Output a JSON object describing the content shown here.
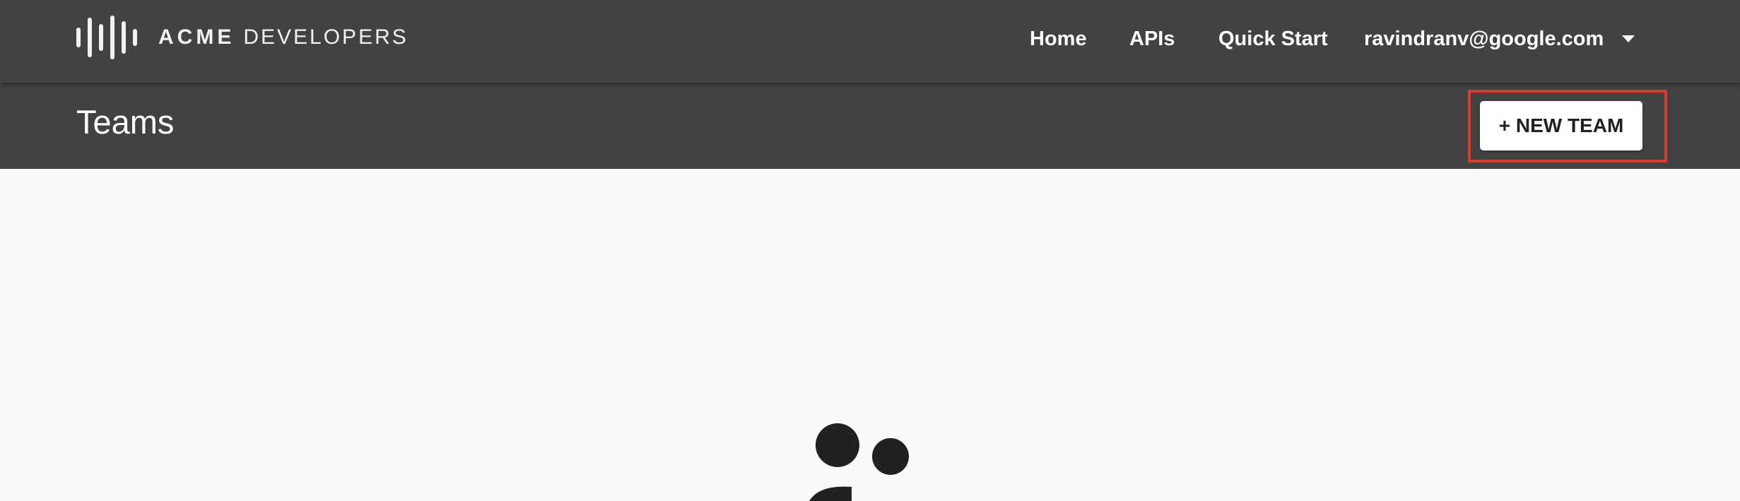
{
  "header": {
    "logo": {
      "brand": "ACME",
      "product": "DEVELOPERS"
    },
    "nav": {
      "home_label": "Home",
      "apis_label": "APIs",
      "quick_start_label": "Quick Start",
      "user_email": "ravindranv@google.com"
    }
  },
  "page": {
    "title": "Teams",
    "new_team_label": "+ NEW TEAM"
  },
  "colors": {
    "header_bg": "#424242",
    "page_bg": "#fafafa",
    "highlight": "#e0392b",
    "button_bg": "#ffffff",
    "illustration": "#212121"
  },
  "icons": {
    "logo": "acme-bars-logo-icon",
    "user_menu": "caret-down-icon",
    "empty_state": "people-illustration-icon"
  }
}
